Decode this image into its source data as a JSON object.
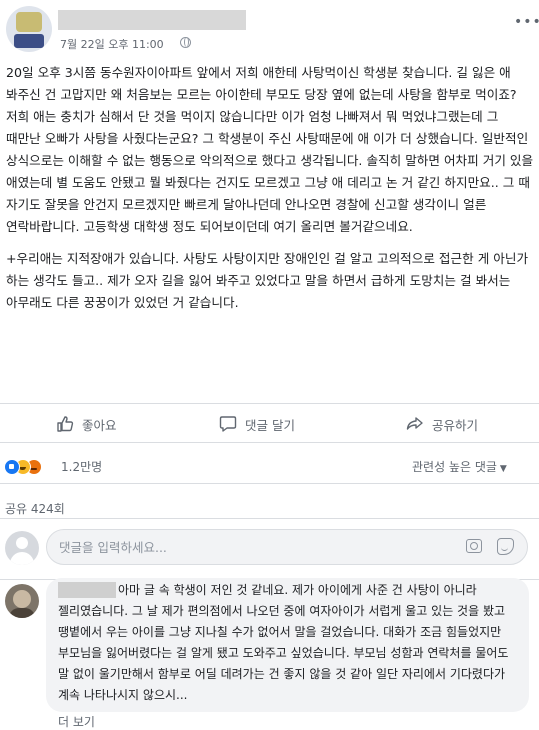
{
  "post": {
    "timestamp": "7월 22일 오후 11:00",
    "paragraphs": [
      "20일 오후 3시쯤 동수원자이아파트 앞에서 저희 애한테 사탕먹이신 학생분 찾습니다. 길 잃은 애 봐주신 건 고맙지만 왜 처음보는 모르는 아이한테 부모도 당장 옆에 없는데 사탕을 함부로 먹이죠? 저희 애는 충치가 심해서 단 것을 먹이지 않습니다만 이가 엄청 나빠져서 뭐 먹었냐그랬는데 그 때만난 오빠가 사탕을 사줬다는군요? 그 학생분이 주신 사탕때문에 애 이가 더 상했습니다. 일반적인 상식으로는 이해할 수 없는 행동으로 악의적으로 했다고 생각됩니다. 솔직히 말하면 어차피 거기 있을 애였는데 별 도움도 안됐고 뭘 봐줬다는 건지도 모르겠고 그냥 애 데리고 논 거 같긴 하지만요.. 그 때 자기도 잘못을 안건지 모르겠지만 빠르게 달아나던데 안나오면 경찰에 신고할 생각이니 얼른 연락바랍니다. 고등학생 대학생 정도 되어보이던데 여기 올리면 볼거같으네요.",
      "+우리애는 지적장애가 있습니다. 사탕도 사탕이지만 장애인인 걸 알고 고의적으로 접근한 게 아닌가 하는 생각도 들고.. 제가 오자 길을 잃어 봐주고 있었다고 말을 하면서 급하게 도망치는 걸 봐서는 아무래도 다른 꿍꿍이가 있었던 거 같습니다."
    ]
  },
  "actions": {
    "like": "좋아요",
    "comment": "댓글 달기",
    "share": "공유하기"
  },
  "stats": {
    "reaction_count": "1.2만명",
    "sort_label": "관련성 높은 댓글",
    "share_count": "공유 424회"
  },
  "comment_input": {
    "placeholder": "댓글을 입력하세요..."
  },
  "comment": {
    "text": "아마 글 속 학생이 저인 것 같네요. 제가 아이에게 사준 건 사탕이 아니라 젤리였습니다. 그 날 제가 편의점에서 나오던 중에 여자아이가 서럽게 울고 있는 것을 봤고 땡볕에서 우는 아이를 그냥 지나칠 수가 없어서 말을 걸었습니다. 대화가 조금 힘들었지만 부모님을 잃어버렸다는 걸 알게 됐고 도와주고 싶었습니다. 부모님 성함과 연락처를 물어도 말 없이 울기만해서 함부로 어딜 데려가는 건 좋지 않을 것 같아 일단 자리에서 기다렸다가 계속 나타나시지 않으시...",
    "see_more": "더 보기"
  },
  "colors": {
    "like_blue": "#1877f2",
    "muted_text": "#606770",
    "bubble_bg": "#f2f3f5"
  }
}
